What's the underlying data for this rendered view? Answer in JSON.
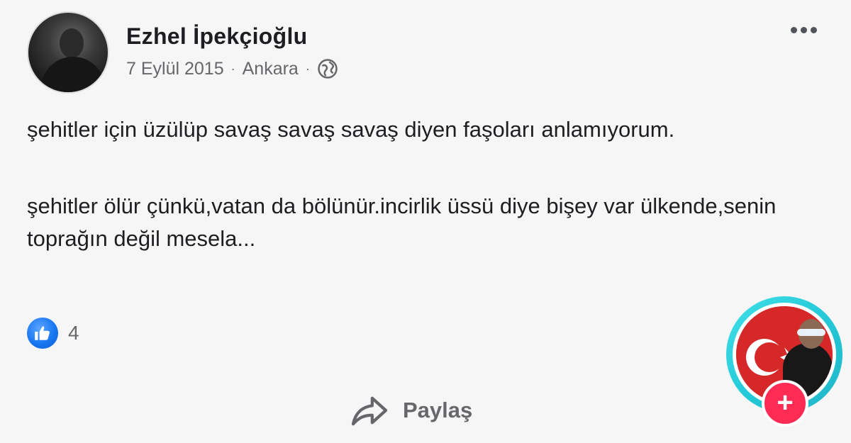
{
  "author": {
    "name": "Ezhel İpekçioğlu"
  },
  "meta": {
    "date": "7 Eylül 2015",
    "separator": "·",
    "location": "Ankara",
    "privacy_icon": "globe-icon"
  },
  "post": {
    "paragraph_1": "şehitler için üzülüp savaş savaş savaş diyen faşoları anlamıyorum.",
    "paragraph_2": "şehitler ölür çünkü,vatan da bölünür.incirlik üssü diye bişey var ülkende,senin toprağın değil mesela..."
  },
  "reactions": {
    "icon": "like-icon",
    "count": "4"
  },
  "actions": {
    "share_label": "Paylaş",
    "share_icon": "share-icon",
    "more_icon": "more-dots-icon"
  },
  "overlay": {
    "follow_icon": "plus-icon",
    "follow_symbol": "+",
    "ring_color": "#25c9d8",
    "follow_color": "#fe2c55",
    "flag_color": "#d62828"
  }
}
